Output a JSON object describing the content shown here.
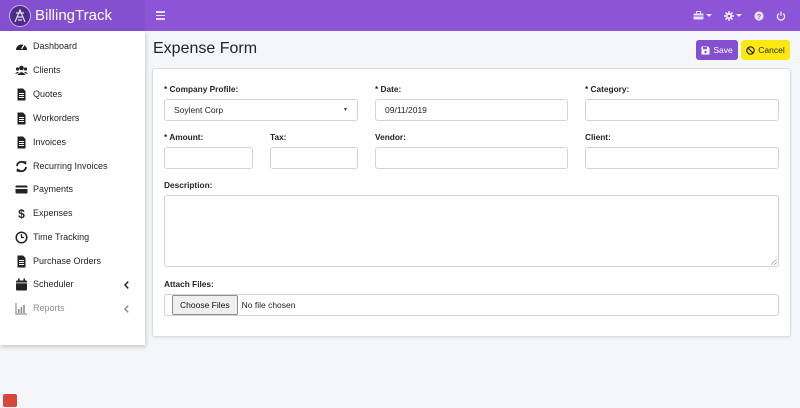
{
  "app": {
    "brand": "BillingTrack"
  },
  "nav": {
    "menu_icon": "hamburger-icon",
    "right_icons": [
      "company-icon",
      "gear-icon",
      "help-icon",
      "power-icon"
    ]
  },
  "sidebar": {
    "items": [
      {
        "label": "Dashboard",
        "icon": "dashboard-icon"
      },
      {
        "label": "Clients",
        "icon": "users-icon"
      },
      {
        "label": "Quotes",
        "icon": "document-icon"
      },
      {
        "label": "Workorders",
        "icon": "document-icon"
      },
      {
        "label": "Invoices",
        "icon": "document-icon"
      },
      {
        "label": "Recurring Invoices",
        "icon": "refresh-icon"
      },
      {
        "label": "Payments",
        "icon": "credit-card-icon"
      },
      {
        "label": "Expenses",
        "icon": "dollar-icon"
      },
      {
        "label": "Time Tracking",
        "icon": "clock-icon"
      },
      {
        "label": "Purchase Orders",
        "icon": "document-icon"
      },
      {
        "label": "Scheduler",
        "icon": "calendar-icon"
      },
      {
        "label": "Reports",
        "icon": "chart-icon"
      }
    ]
  },
  "page": {
    "title": "Expense Form"
  },
  "toolbar": {
    "save_label": "Save",
    "cancel_label": "Cancel"
  },
  "form": {
    "company_profile": {
      "label": "* Company Profile:",
      "value": "Soylent Corp"
    },
    "date": {
      "label": "* Date:",
      "value": "09/11/2019"
    },
    "category": {
      "label": "* Category:",
      "value": ""
    },
    "amount": {
      "label": "* Amount:",
      "value": ""
    },
    "tax": {
      "label": "Tax:",
      "value": ""
    },
    "vendor": {
      "label": "Vendor:",
      "value": ""
    },
    "client": {
      "label": "Client:",
      "value": ""
    },
    "description": {
      "label": "Description:",
      "value": ""
    },
    "attach": {
      "label": "Attach Files:",
      "button": "Choose Files",
      "status": "No file chosen"
    }
  },
  "colors": {
    "primary": "#8c54d6",
    "warning": "#fde910",
    "background": "#f4f6f9"
  }
}
